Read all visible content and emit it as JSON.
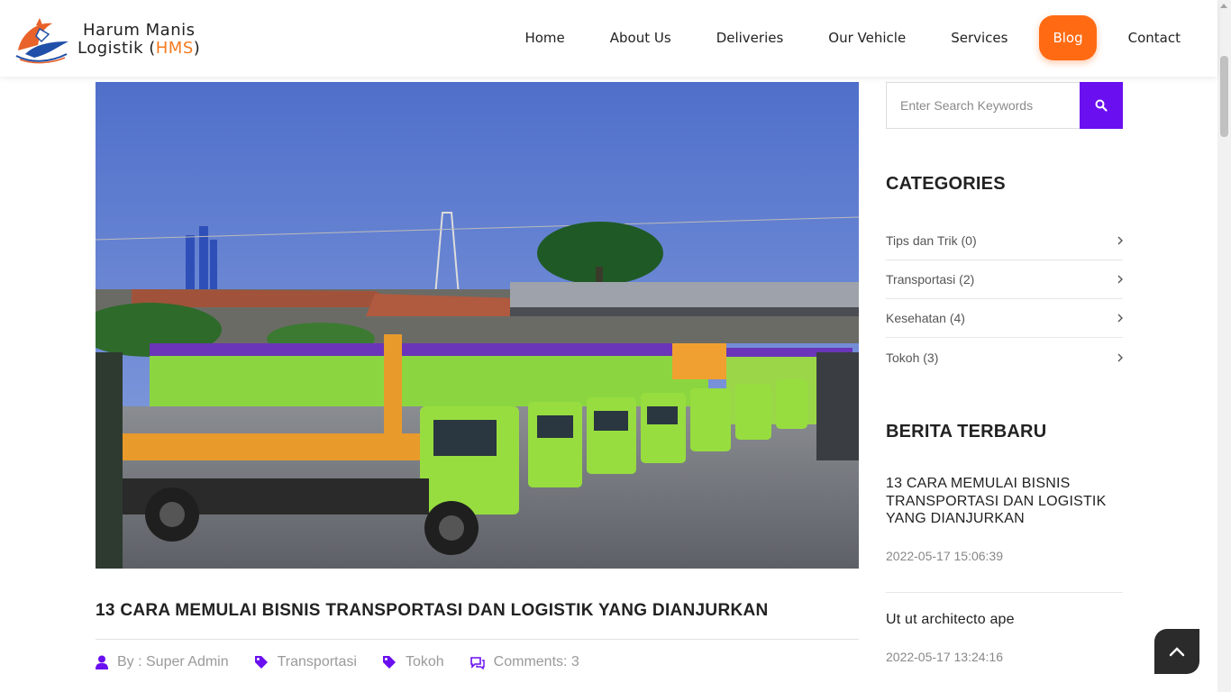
{
  "brand": {
    "line1": "Harum Manis",
    "line2_prefix": "Logistik (",
    "line2_hms": "HMS",
    "line2_suffix": ")",
    "accent": "#f47a1f"
  },
  "nav": {
    "items": [
      {
        "label": "Home"
      },
      {
        "label": "About Us"
      },
      {
        "label": "Deliveries"
      },
      {
        "label": "Our Vehicle"
      },
      {
        "label": "Services"
      },
      {
        "label": "Blog",
        "active": true
      },
      {
        "label": "Contact"
      }
    ],
    "active_color": "#ff6a13"
  },
  "post": {
    "title": "13 CARA MEMULAI BISNIS TRANSPORTASI DAN LOGISTIK YANG DIANJURKAN",
    "meta": {
      "author": "By : Super Admin",
      "category": "Transportasi",
      "tag": "Tokoh",
      "comments": "Comments: 3"
    },
    "meta_icon_color": "#6a0ff0"
  },
  "sidebar": {
    "search": {
      "placeholder": "Enter Search Keywords",
      "button_color": "#6a0ff0",
      "icon": "search-icon"
    },
    "categories_heading": "CATEGORIES",
    "categories": [
      {
        "label": "Tips dan Trik (0)"
      },
      {
        "label": "Transportasi (2)"
      },
      {
        "label": "Kesehatan (4)"
      },
      {
        "label": "Tokoh (3)"
      }
    ],
    "recent_heading": "BERITA TERBARU",
    "recent": [
      {
        "title": "13 CARA MEMULAI BISNIS TRANSPORTASI DAN LOGISTIK YANG DIANJURKAN",
        "date": "2022-05-17 15:06:39"
      },
      {
        "title": "Ut ut architecto ape",
        "date": "2022-05-17 13:24:16"
      }
    ]
  },
  "back_to_top": {
    "icon": "chevron-up-icon"
  }
}
